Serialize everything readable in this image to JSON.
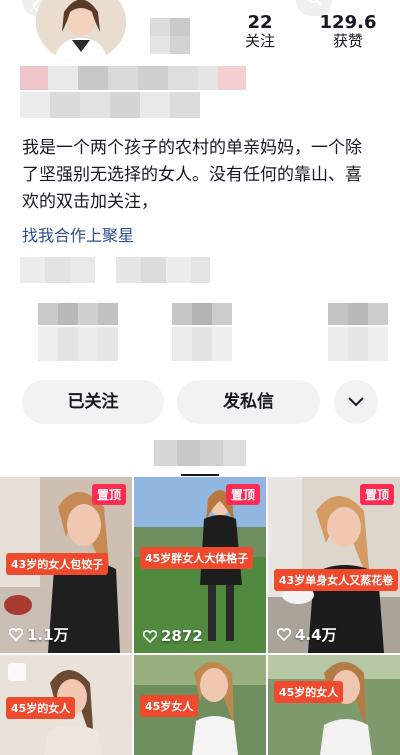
{
  "header": {
    "following_label": "关注",
    "likes_label": "获赞",
    "following_count": "22",
    "likes_count": "129.6万"
  },
  "bio": {
    "text": "我是一个两个孩子的农村的单亲妈妈，一个除了坚强别无选择的女人。没有任何的靠山、喜欢的双击加关注，",
    "cta": "找我合作上聚星"
  },
  "actions": {
    "follow_label": "已关注",
    "message_label": "发私信",
    "more_icon": "chevron-down-icon"
  },
  "videos": [
    {
      "caption": "43岁的女人包饺子",
      "pinned": "置顶",
      "likes": "1.1万"
    },
    {
      "caption": "45岁胖女人大体格子",
      "pinned": "置顶",
      "likes": "2872"
    },
    {
      "caption": "43岁单身女人又蒸花卷",
      "pinned": "置顶",
      "likes": "4.4万"
    },
    {
      "caption": "45岁的女人"
    },
    {
      "caption": "45岁女人"
    },
    {
      "caption": "45岁的女人"
    }
  ],
  "colors": {
    "pin_badge": "#fe2c55",
    "caption_badge": "#f04a2e",
    "link": "#2f4f8f",
    "button_bg": "#f1f2f2"
  }
}
